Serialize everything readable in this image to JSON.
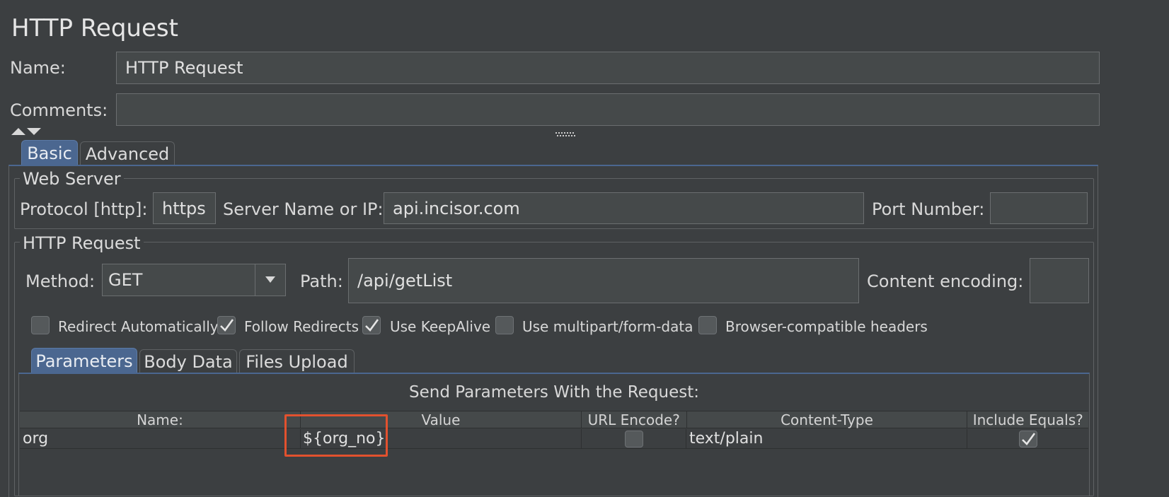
{
  "window": {
    "title": "HTTP Request"
  },
  "name_row": {
    "label": "Name:",
    "value": "HTTP Request"
  },
  "comments_row": {
    "label": "Comments:",
    "value": ""
  },
  "tabs": [
    {
      "label": "Basic",
      "active": true
    },
    {
      "label": "Advanced",
      "active": false
    }
  ],
  "web_server": {
    "legend": "Web Server",
    "protocol_label": "Protocol [http]:",
    "protocol_value": "https",
    "server_label": "Server Name or IP:",
    "server_value": "api.incisor.com",
    "port_label": "Port Number:",
    "port_value": ""
  },
  "http_request": {
    "legend": "HTTP Request",
    "method_label": "Method:",
    "method_value": "GET",
    "path_label": "Path:",
    "path_value": "/api/getList",
    "encoding_label": "Content encoding:",
    "encoding_value": "",
    "checkboxes": [
      {
        "label": "Redirect Automatically",
        "checked": false
      },
      {
        "label": "Follow Redirects",
        "checked": true
      },
      {
        "label": "Use KeepAlive",
        "checked": true
      },
      {
        "label": "Use multipart/form-data",
        "checked": false
      },
      {
        "label": "Browser-compatible headers",
        "checked": false
      }
    ]
  },
  "param_tabs": [
    {
      "label": "Parameters",
      "active": true
    },
    {
      "label": "Body Data",
      "active": false
    },
    {
      "label": "Files Upload",
      "active": false
    }
  ],
  "params": {
    "title": "Send Parameters With the Request:",
    "columns": [
      "Name:",
      "Value",
      "URL Encode?",
      "Content-Type",
      "Include Equals?"
    ],
    "rows": [
      {
        "name": "org",
        "value": "${org_no}",
        "url_encode": false,
        "content_type": "text/plain",
        "include_equals": true
      }
    ],
    "highlight_color": "#e2512e"
  },
  "colors": {
    "background": "#3c3f41",
    "active_tab": "#4b6790",
    "field": "#45494a"
  }
}
